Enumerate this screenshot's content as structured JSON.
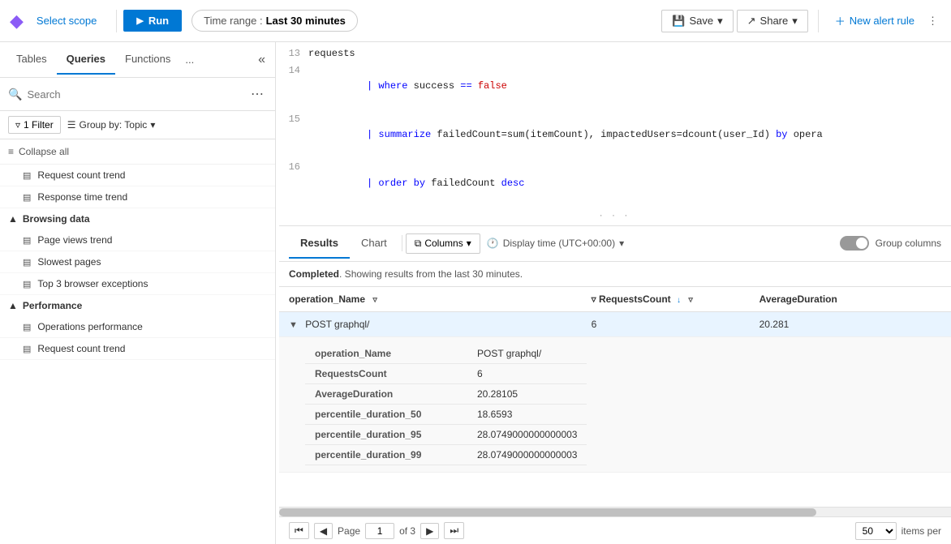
{
  "topbar": {
    "logo": "◆",
    "select_scope": "Select scope",
    "run_label": "Run",
    "time_range_label": "Time range :",
    "time_range_value": "Last 30 minutes",
    "save_label": "Save",
    "share_label": "Share",
    "new_alert_label": "New alert rule"
  },
  "sidebar": {
    "tabs": [
      {
        "label": "Tables",
        "active": false
      },
      {
        "label": "Queries",
        "active": true
      },
      {
        "label": "Functions",
        "active": false
      }
    ],
    "more_label": "...",
    "collapse_icon": "«",
    "search_placeholder": "Search",
    "filter_label": "1 Filter",
    "group_by_label": "Group by: Topic",
    "collapse_all_label": "Collapse all",
    "sections": [
      {
        "label": "",
        "items": [
          {
            "label": "Request count trend"
          },
          {
            "label": "Response time trend"
          }
        ]
      },
      {
        "label": "Browsing data",
        "items": [
          {
            "label": "Page views trend"
          },
          {
            "label": "Slowest pages"
          },
          {
            "label": "Top 3 browser exceptions"
          }
        ]
      },
      {
        "label": "Performance",
        "items": [
          {
            "label": "Operations performance"
          },
          {
            "label": "Request count trend"
          }
        ]
      }
    ]
  },
  "editor": {
    "lines": [
      {
        "num": "13",
        "content": "requests"
      },
      {
        "num": "14",
        "content": "| where success == false"
      },
      {
        "num": "15",
        "content": "| summarize failedCount=sum(itemCount), impactedUsers=dcount(user_Id) by opera"
      },
      {
        "num": "16",
        "content": "| order by failedCount desc"
      }
    ]
  },
  "results": {
    "tabs": [
      {
        "label": "Results",
        "active": true
      },
      {
        "label": "Chart",
        "active": false
      }
    ],
    "columns_label": "Columns",
    "display_time_label": "Display time (UTC+00:00)",
    "group_columns_label": "Group columns",
    "status_text": "Completed",
    "status_detail": ". Showing results from the last 30 minutes.",
    "table": {
      "columns": [
        "operation_Name",
        "RequestsCount",
        "AverageDuration"
      ],
      "rows": [
        {
          "operation_Name": "POST graphql/",
          "RequestsCount": "6",
          "AverageDuration": "20.281",
          "expanded": true,
          "details": [
            {
              "key": "operation_Name",
              "value": "POST graphql/"
            },
            {
              "key": "RequestsCount",
              "value": "6"
            },
            {
              "key": "AverageDuration",
              "value": "20.28105"
            },
            {
              "key": "percentile_duration_50",
              "value": "18.6593"
            },
            {
              "key": "percentile_duration_95",
              "value": "28.0749000000000003"
            },
            {
              "key": "percentile_duration_99",
              "value": "28.0749000000000003"
            }
          ]
        }
      ]
    },
    "pagination": {
      "page_label": "Page",
      "page_value": "1",
      "of_label": "of 3",
      "per_page_value": "50",
      "items_per_label": "items per"
    }
  }
}
